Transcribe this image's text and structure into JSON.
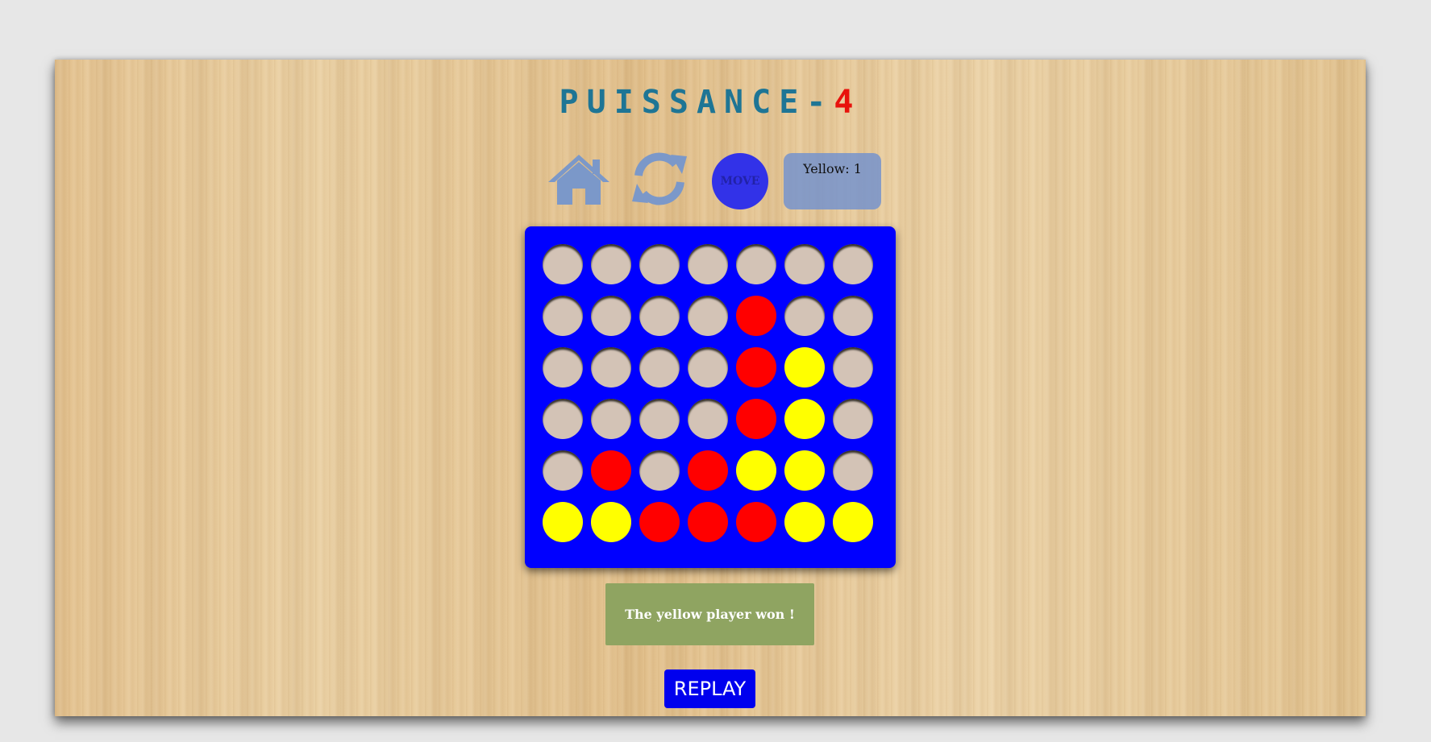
{
  "title": {
    "main": "PUISSANCE-",
    "accent": "4"
  },
  "toolbar": {
    "home_icon": "home-icon",
    "reload_icon": "reload-icon",
    "move_label": "MOVE",
    "score_label": "Yellow: 1"
  },
  "colors": {
    "board": "#0000ff",
    "red": "#ff0000",
    "yellow": "#ffff00",
    "empty": "#d3c3b6",
    "title": "#1e7595",
    "title_accent": "#e8120c"
  },
  "board": [
    [
      "empty",
      "empty",
      "empty",
      "empty",
      "empty",
      "empty",
      "empty"
    ],
    [
      "empty",
      "empty",
      "empty",
      "empty",
      "red",
      "empty",
      "empty"
    ],
    [
      "empty",
      "empty",
      "empty",
      "empty",
      "red",
      "yellow",
      "empty"
    ],
    [
      "empty",
      "empty",
      "empty",
      "empty",
      "red",
      "yellow",
      "empty"
    ],
    [
      "empty",
      "red",
      "empty",
      "red",
      "yellow",
      "yellow",
      "empty"
    ],
    [
      "yellow",
      "yellow",
      "red",
      "red",
      "red",
      "yellow",
      "yellow"
    ]
  ],
  "message": "The yellow player won !",
  "replay_label": "REPLAY"
}
